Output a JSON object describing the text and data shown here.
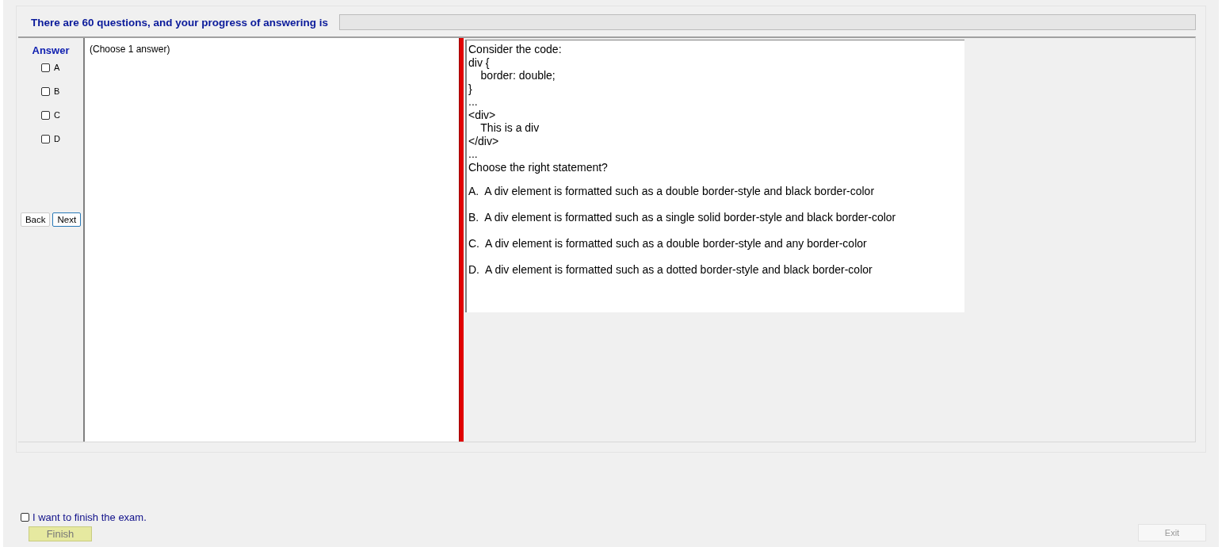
{
  "header": {
    "progress_text": "There are 60 questions, and your progress of answering is",
    "progress": {
      "level": 0
    }
  },
  "answer_panel": {
    "title": "Answer",
    "choices": [
      {
        "label": "A",
        "checked": false
      },
      {
        "label": "B",
        "checked": false
      },
      {
        "label": "C",
        "checked": false
      },
      {
        "label": "D",
        "checked": false
      }
    ],
    "buttons": [
      {
        "label": "Back",
        "focused": false
      },
      {
        "label": "Next",
        "focused": true
      }
    ]
  },
  "answer_area": {
    "instruction": "(Choose 1 answer)"
  },
  "question": {
    "lines": [
      "Consider the code:",
      "div {",
      "    border: double;",
      "}",
      "...",
      "<div>",
      "    This is a div",
      "</div>",
      "...",
      "Choose the right statement?"
    ],
    "options": [
      "A.  A div element is formatted such as a double border-style and black border-color",
      "B.  A div element is formatted such as a single solid border-style and black border-color",
      "C.  A div element is formatted such as a double border-style and any border-color",
      "D.  A div element is formatted such as a dotted border-style and black border-color"
    ]
  },
  "footer": {
    "finish_check": {
      "label": "I want to finish the exam.",
      "checked": false
    },
    "finish_button": {
      "label": "Finish",
      "disabled": true
    },
    "exit_button": {
      "label": "Exit",
      "disabled": true
    }
  }
}
